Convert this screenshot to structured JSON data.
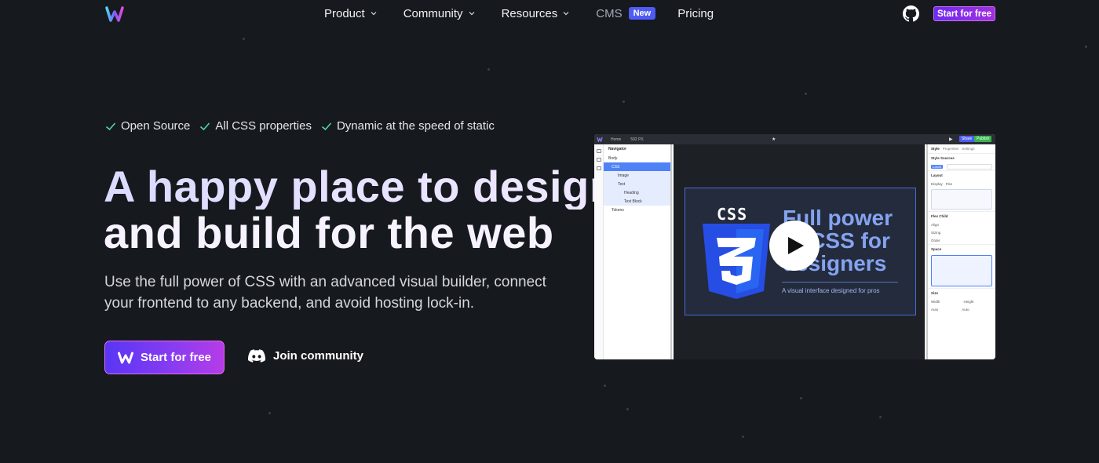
{
  "nav": {
    "items": [
      {
        "label": "Product",
        "dropdown": true
      },
      {
        "label": "Community",
        "dropdown": true
      },
      {
        "label": "Resources",
        "dropdown": true
      },
      {
        "label": "CMS",
        "badge": "New"
      },
      {
        "label": "Pricing"
      }
    ],
    "cta": "Start for free",
    "github_icon": "github-icon",
    "logo_icon": "webstudio-logo"
  },
  "features": [
    "Open Source",
    "All CSS properties",
    "Dynamic at the speed of static"
  ],
  "hero": {
    "title_line1": "A happy place to design",
    "title_line2": "and build for the web",
    "subtitle": "Use the full power of CSS with an advanced visual builder, connect your frontend to any backend, and avoid hosting lock-in.",
    "primary_button": "Start for free",
    "secondary_button": "Join community"
  },
  "builder": {
    "topbar": {
      "home": "Home",
      "px": "592 PX",
      "share": "Share",
      "publish": "Publish"
    },
    "navigator": {
      "title": "Navigator",
      "rows": [
        "Body",
        "CSS",
        "Image",
        "Text",
        "Heading",
        "Text Block",
        "Tokens"
      ]
    },
    "canvas": {
      "css_word": "CSS",
      "headline_1": "Full power",
      "headline_2": "of CSS for",
      "headline_3": "designers",
      "caption": "A visual interface designed for pros"
    },
    "style_panel": {
      "tabs": [
        "Style",
        "Properties",
        "Settings"
      ],
      "sections": [
        "Style Sources",
        "Layout",
        "Flex Child",
        "Space",
        "Size"
      ],
      "source_tag": "Local",
      "display_label": "Display",
      "display_value": "Flex",
      "flex_rows": [
        "Align",
        "Sizing",
        "Order"
      ],
      "size_labels": [
        "Width",
        "Height"
      ],
      "size_value": "Auto"
    }
  },
  "colors": {
    "background": "#16191d",
    "accent_purple": "#6e2bf0",
    "badge_blue": "#4f5bf5",
    "check_green": "#4fd7a2"
  }
}
